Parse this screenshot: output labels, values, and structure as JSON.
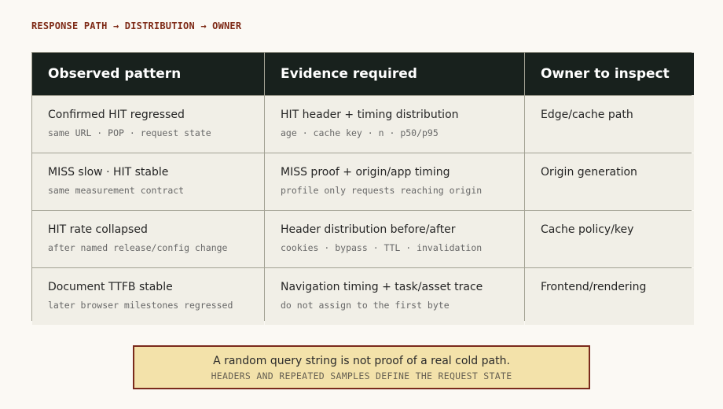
{
  "kicker": "RESPONSE PATH → DISTRIBUTION → OWNER",
  "table": {
    "headers": [
      "Observed pattern",
      "Evidence required",
      "Owner to inspect"
    ],
    "rows": [
      {
        "pattern": "Confirmed HIT regressed",
        "pattern_note": "same URL · POP · request state",
        "evidence": "HIT header + timing distribution",
        "evidence_note": "age · cache key · n · p50/p95",
        "owner": "Edge/cache path"
      },
      {
        "pattern": "MISS slow · HIT stable",
        "pattern_note": "same measurement contract",
        "evidence": "MISS proof + origin/app timing",
        "evidence_note": "profile only requests reaching origin",
        "owner": "Origin generation"
      },
      {
        "pattern": "HIT rate collapsed",
        "pattern_note": "after named release/config change",
        "evidence": "Header distribution before/after",
        "evidence_note": "cookies · bypass · TTL · invalidation",
        "owner": "Cache policy/key"
      },
      {
        "pattern": "Document TTFB stable",
        "pattern_note": "later browser milestones regressed",
        "evidence": "Navigation timing + task/asset trace",
        "evidence_note": "do not assign to the first byte",
        "owner": "Frontend/rendering"
      }
    ]
  },
  "callout": {
    "text": "A random query string is not proof of a real cold path.",
    "subtext": "HEADERS AND REPEATED SAMPLES DEFINE THE REQUEST STATE"
  },
  "colors": {
    "header_bg": "#18211d",
    "accent": "#7e2a16",
    "callout_bg": "#f3e2aa"
  }
}
